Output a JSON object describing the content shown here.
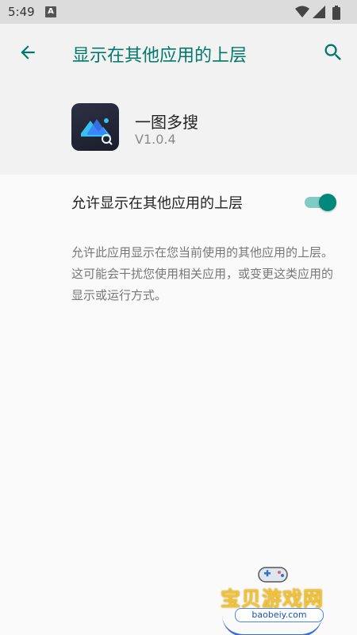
{
  "status_bar": {
    "time": "5:49",
    "notification_icon": "a-icon",
    "icons": [
      "wifi-icon",
      "signal-icon",
      "battery-icon"
    ]
  },
  "app_bar": {
    "back_icon": "arrow-back-icon",
    "title": "显示在其他应用的上层",
    "search_icon": "search-icon",
    "accent_color": "#00796b"
  },
  "app_info": {
    "name": "一图多搜",
    "version": "V1.0.4"
  },
  "setting": {
    "label": "允许显示在其他应用的上层",
    "enabled": true,
    "toggle_color": "#00897b"
  },
  "description": "允许此应用显示在您当前使用的其他应用的上层。这可能会干扰您使用相关应用，或变更这类应用的显示或运行方式。",
  "watermark": {
    "text": "宝贝游戏网",
    "url": "baobeiy.com"
  }
}
